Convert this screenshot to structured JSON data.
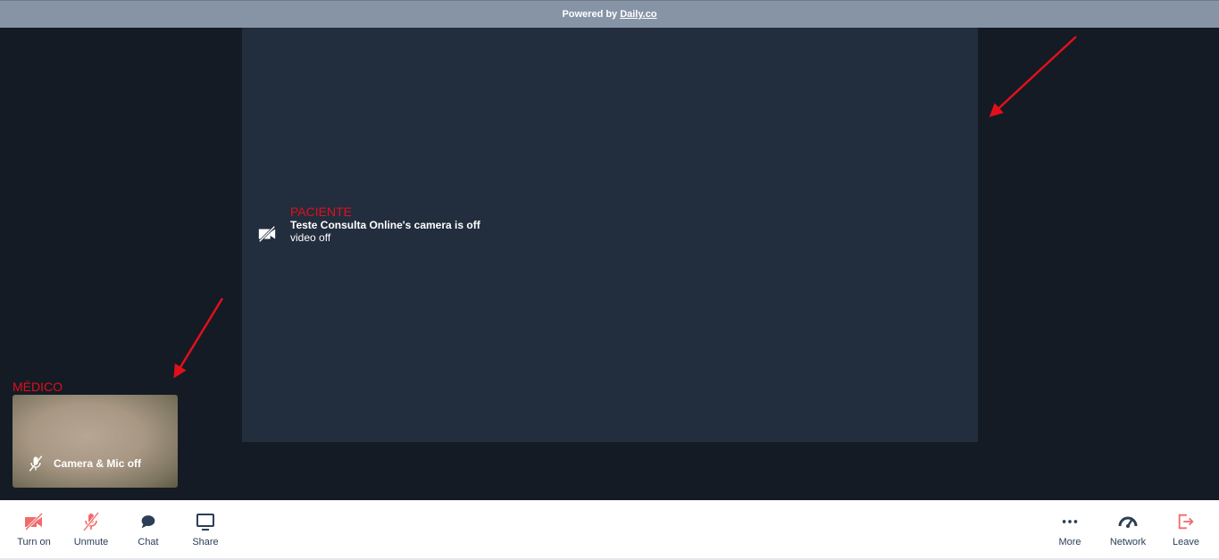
{
  "topbar": {
    "powered_text": "Powered by",
    "brand_link": "Daily.co"
  },
  "main": {
    "annotation": "PACIENTE",
    "name_text": "Teste Consulta Online's camera is off",
    "sub_text": "video off",
    "icon": "camera-off-icon"
  },
  "self_view": {
    "annotation": "MÉDICO",
    "label": "Camera & Mic off",
    "icon": "mic-off-icon"
  },
  "tray": {
    "left": [
      {
        "label": "Turn on",
        "icon": "camera-off-icon"
      },
      {
        "label": "Unmute",
        "icon": "mic-off-icon"
      },
      {
        "label": "Chat",
        "icon": "chat-icon"
      },
      {
        "label": "Share",
        "icon": "screen-share-icon"
      }
    ],
    "right": [
      {
        "label": "More",
        "icon": "more-icon"
      },
      {
        "label": "Network",
        "icon": "network-gauge-icon"
      },
      {
        "label": "Leave",
        "icon": "leave-icon"
      }
    ]
  },
  "colors": {
    "annotation_red": "#e0101b",
    "stage_bg": "#141b25",
    "tile_bg": "#222d3d",
    "topbar_bg": "#8794a6",
    "icon_red": "#f26b6b",
    "icon_dark": "#2b3f56"
  }
}
